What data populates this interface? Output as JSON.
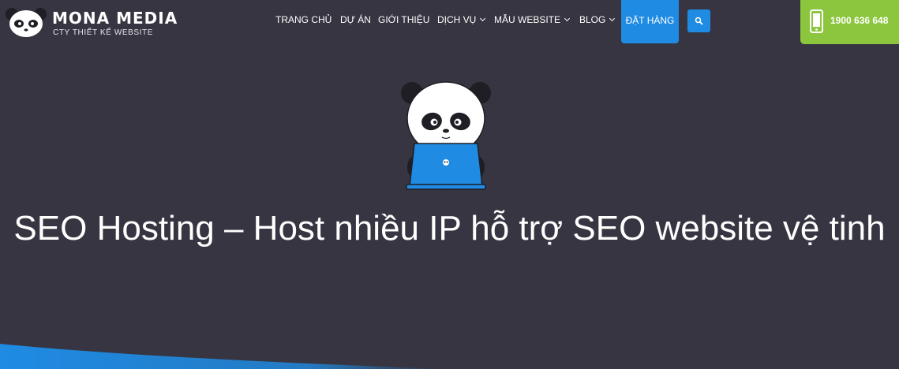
{
  "header": {
    "brand_name": "MONA MEDIA",
    "brand_tagline": "CTY THIẾT KẾ WEBSITE",
    "nav": [
      {
        "label": "TRANG CHỦ"
      },
      {
        "label": "DỰ ÁN"
      },
      {
        "label": "GIỚI THIỆU"
      },
      {
        "label": "DỊCH VỤ"
      },
      {
        "label": "MẪU WEBSITE"
      },
      {
        "label": "BLOG"
      }
    ],
    "order_label": "ĐẶT HÀNG",
    "phone": "1900 636 648"
  },
  "hero": {
    "title": "SEO Hosting – Host nhiều IP hỗ trợ SEO website vệ tinh"
  },
  "colors": {
    "background": "#363541",
    "accent_blue": "#1f8be3",
    "phone_green": "#8cc63f"
  },
  "icons": [
    "panda-logo-icon",
    "search-icon",
    "phone-icon",
    "panda-laptop-illustration"
  ]
}
